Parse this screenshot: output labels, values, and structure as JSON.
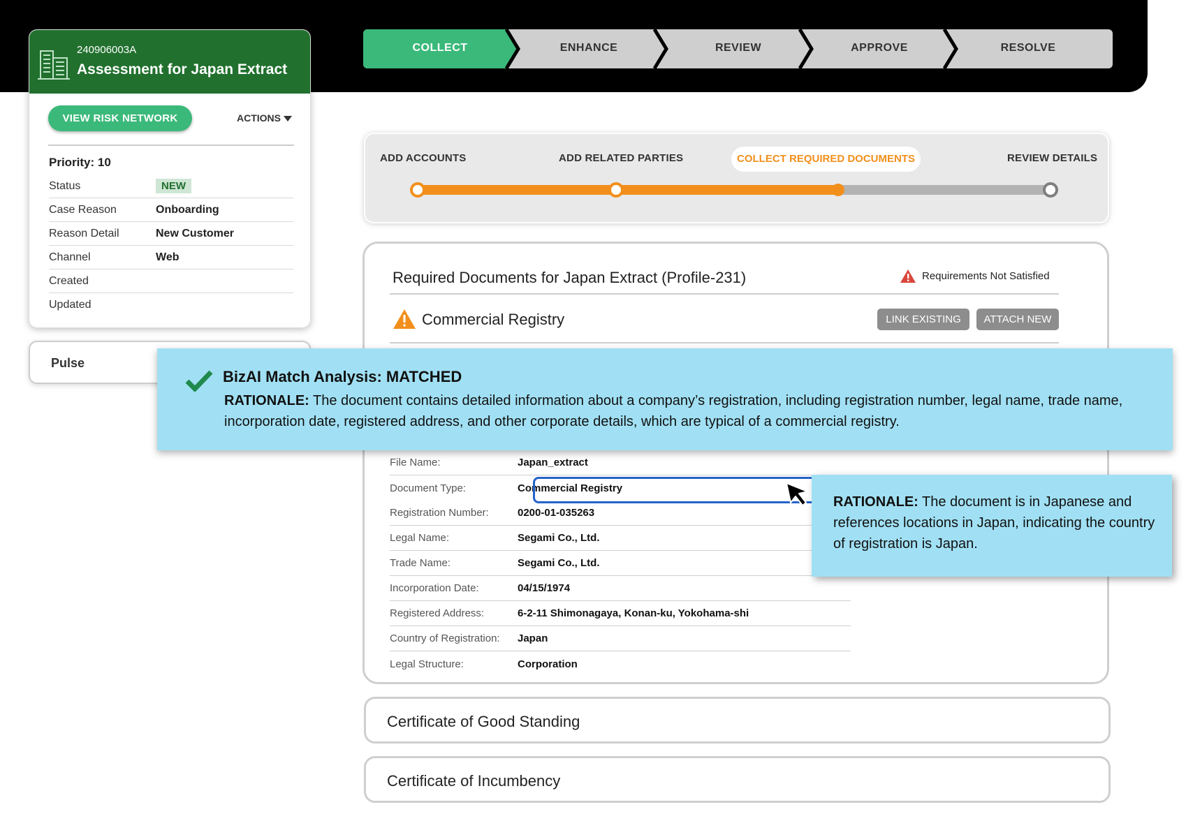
{
  "case": {
    "id": "240906003A",
    "title": "Assessment for Japan Extract",
    "risk_button": "VIEW RISK NETWORK",
    "actions_label": "ACTIONS",
    "priority": "Priority: 10",
    "fields": [
      {
        "key": "Status",
        "value": "NEW"
      },
      {
        "key": "Case Reason",
        "value": "Onboarding"
      },
      {
        "key": "Reason Detail",
        "value": "New Customer"
      },
      {
        "key": "Channel",
        "value": "Web"
      },
      {
        "key": "Created",
        "value": ""
      },
      {
        "key": "Updated",
        "value": ""
      }
    ]
  },
  "pulse": {
    "label": "Pulse"
  },
  "process_steps": [
    "COLLECT",
    "ENHANCE",
    "REVIEW",
    "APPROVE",
    "RESOLVE"
  ],
  "process_active": "COLLECT",
  "sub_steps": [
    "ADD ACCOUNTS",
    "ADD RELATED PARTIES",
    "COLLECT REQUIRED DOCUMENTS",
    "REVIEW DETAILS"
  ],
  "sub_active": "COLLECT REQUIRED DOCUMENTS",
  "docs": {
    "title": "Required Documents for Japan Extract (Profile-231)",
    "status": "Requirements Not Satisfied",
    "section_title": "Commercial Registry",
    "link_existing": "LINK EXISTING",
    "attach_new": "ATTACH NEW",
    "fields": [
      {
        "key": "File Name:",
        "value": "Japan_extract"
      },
      {
        "key": "Document Type:",
        "value": "Commercial Registry"
      },
      {
        "key": "Registration Number:",
        "value": "0200-01-035263"
      },
      {
        "key": "Legal Name:",
        "value": "Segami Co., Ltd."
      },
      {
        "key": "Trade Name:",
        "value": "Segami Co., Ltd."
      },
      {
        "key": "Incorporation Date:",
        "value": "04/15/1974"
      },
      {
        "key": "Registered Address:",
        "value": "6-2-11 Shimonagaya, Konan-ku, Yokohama-shi"
      },
      {
        "key": "Country of Registration:",
        "value": "Japan"
      },
      {
        "key": "Legal Structure:",
        "value": "Corporation"
      }
    ],
    "other_docs": [
      "Certificate of Good Standing",
      "Certificate of Incumbency"
    ]
  },
  "match": {
    "title": "BizAI Match Analysis: MATCHED",
    "rationale_label": "RATIONALE:",
    "rationale_text": " The document contains detailed information about a company’s registration, including registration number, legal name, trade name, incorporation date, registered address, and other corporate details, which are typical of a commercial registry."
  },
  "country_rationale": {
    "label": "RATIONALE:",
    "text": " The document is in Japanese and references locations in Japan, indicating the country of registration is Japan."
  },
  "colors": {
    "header_green": "#21702e",
    "accent_green": "#3bb97a",
    "orange": "#f28f1c",
    "tooltip_blue": "#a1e0f4",
    "focus_blue": "#2563c9"
  },
  "icons": [
    "building-icon",
    "caret-down-icon",
    "warning-icon",
    "checkmark-icon",
    "cursor-icon"
  ]
}
